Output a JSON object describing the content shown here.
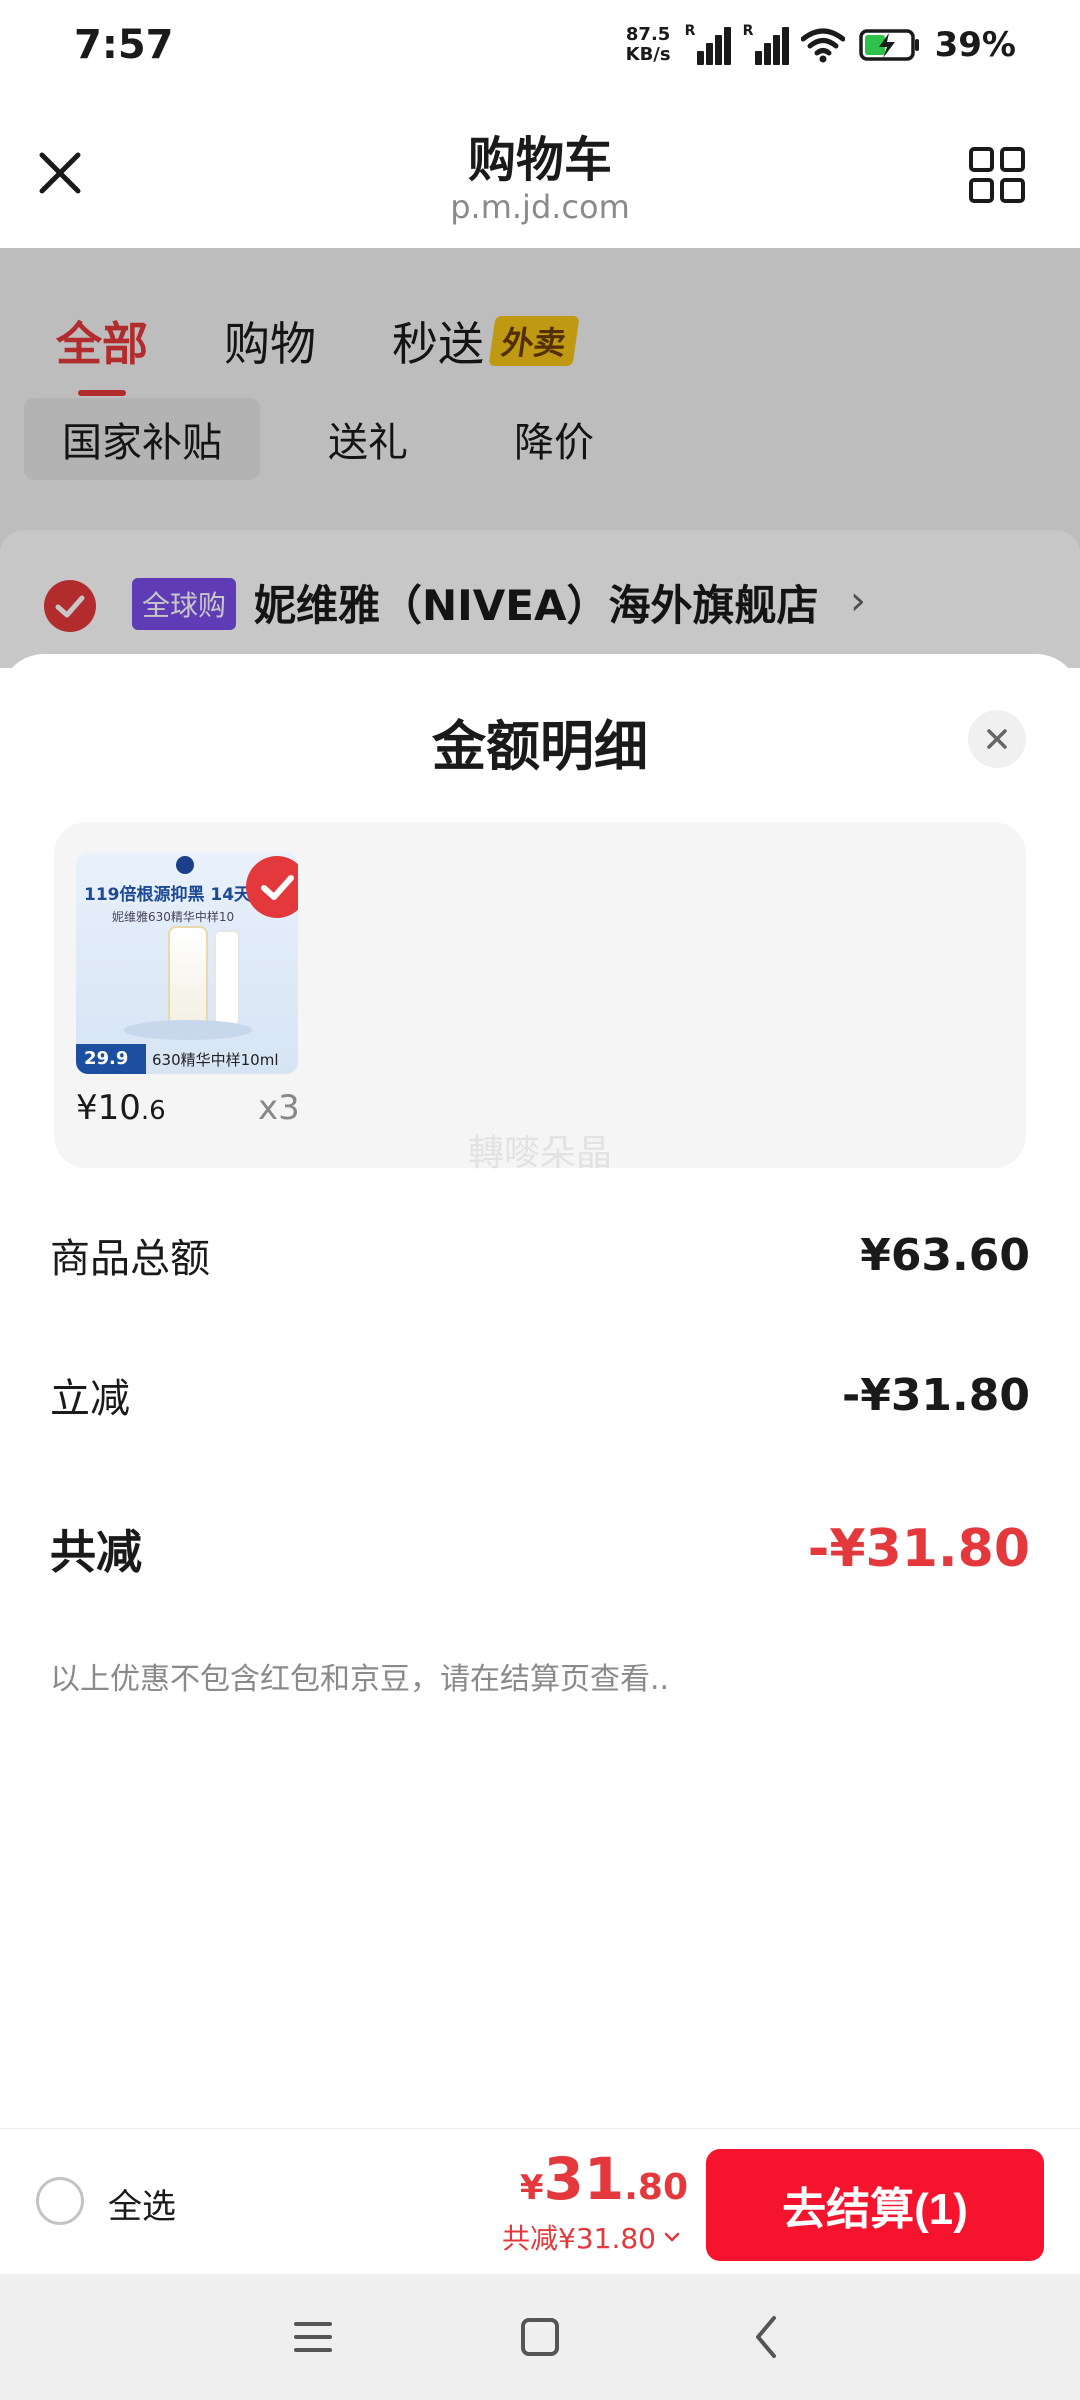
{
  "status_bar": {
    "time": "7:57",
    "net_speed_value": "87.5",
    "net_speed_unit": "KB/s",
    "signal_1_label": "R",
    "signal_2_label": "R",
    "battery_percent": "39%"
  },
  "nav": {
    "title": "购物车",
    "url": "p.m.jd.com",
    "close_icon": "close-icon",
    "grid_icon": "grid-icon"
  },
  "background_page": {
    "tabs": [
      {
        "label": "全部",
        "active": true
      },
      {
        "label": "购物",
        "active": false
      },
      {
        "label": "秒送",
        "active": false,
        "badge": "外卖"
      }
    ],
    "chips": [
      {
        "label": "国家补贴",
        "selected": true
      },
      {
        "label": "送礼",
        "selected": false
      },
      {
        "label": "降价",
        "selected": false
      }
    ],
    "store": {
      "tag": "全球购",
      "name": "妮维雅（NIVEA）海外旗舰店",
      "chevron": "›"
    }
  },
  "sheet": {
    "title": "金额明细",
    "product": {
      "image": {
        "headline": "119倍根源抑黑 14天",
        "subline": "妮维雅630精华中样10",
        "price_tag": "29.9",
        "caption": "630精华中样10ml"
      },
      "price_main": "¥10",
      "price_decimal": ".6",
      "quantity": "x3"
    },
    "watermark": "轉嘜朵晶",
    "rows": [
      {
        "label": "商品总额",
        "value": "¥63.60"
      },
      {
        "label": "立减",
        "value": "-¥31.80"
      },
      {
        "label": "共减",
        "value": "-¥31.80"
      }
    ],
    "note": "以上优惠不包含红包和京豆，请在结算页查看.."
  },
  "checkout": {
    "select_all_label": "全选",
    "total_currency": "¥",
    "total_int": "31",
    "total_dec": ".80",
    "total_discount": "共减¥31.80",
    "button_label": "去结算(1)"
  },
  "colors": {
    "accent_red": "#e4393c",
    "checkout_red": "#f5132e",
    "global_tag_purple": "#7a4ee8",
    "badge_yellow": "#f5c518"
  }
}
